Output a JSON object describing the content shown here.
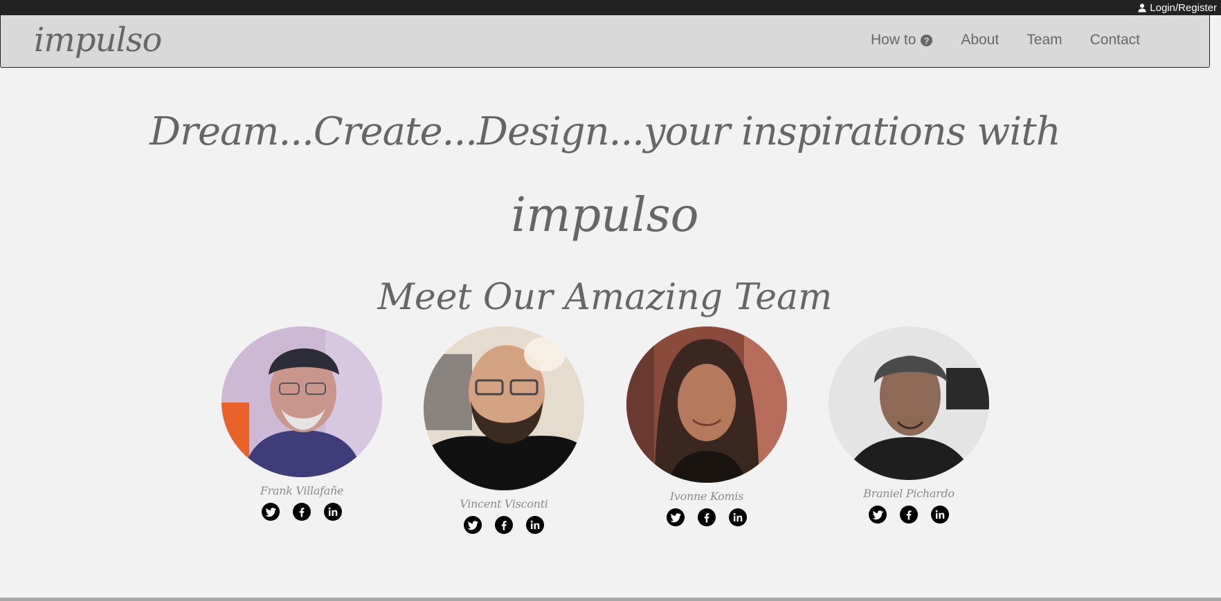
{
  "topbar": {
    "login_label": "Login/Register"
  },
  "navbar": {
    "brand": "impulso",
    "links": [
      {
        "label": "How to",
        "icon": "question-circle-icon"
      },
      {
        "label": "About"
      },
      {
        "label": "Team"
      },
      {
        "label": "Contact"
      }
    ]
  },
  "hero": {
    "headline": "Dream...Create...Design...your inspirations with",
    "brand": "impulso"
  },
  "team": {
    "title": "Meet Our Amazing Team",
    "members": [
      {
        "name": "Frank Villafañe"
      },
      {
        "name": "Vincent Visconti"
      },
      {
        "name": "Ivonne Komis"
      },
      {
        "name": "Braniel Pichardo"
      }
    ],
    "socials": [
      "twitter-icon",
      "facebook-icon",
      "linkedin-icon"
    ]
  },
  "colors": {
    "topbar_bg": "#222222",
    "navbar_bg": "#d9d9d9",
    "page_bg": "#f2f2f2",
    "text_gray": "#666666"
  }
}
